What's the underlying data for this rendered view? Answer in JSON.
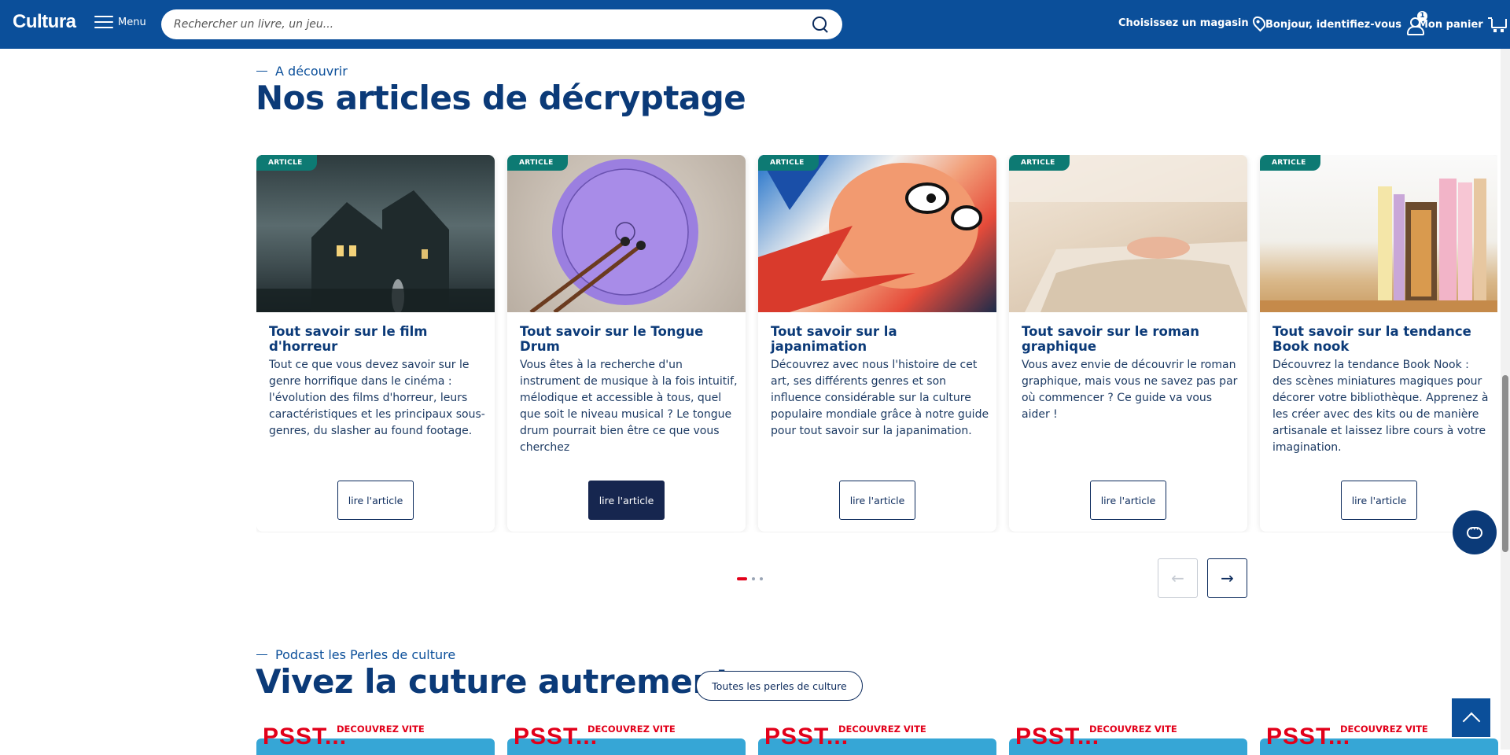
{
  "header": {
    "logo": "Cultura",
    "menu_label": "Menu",
    "search_placeholder": "Rechercher un livre, un jeu...",
    "store_label": "Choisissez un magasin",
    "account_label": "Bonjour, identifiez-vous",
    "account_badge": "1",
    "cart_label": "Mon panier",
    "brand_color": "#0b4f9a"
  },
  "decryptage": {
    "eyebrow": "A découvrir",
    "title": "Nos articles de décryptage",
    "cards": [
      {
        "tag": "ARTICLE",
        "image": "haunted-house-image",
        "title": "Tout savoir sur le film d'horreur",
        "desc": "Tout ce que vous devez savoir sur le genre horrifique dans le cinéma : l'évolution des films d'horreur, leurs caractéristiques et les principaux sous-genres, du slasher au found footage.",
        "button": "lire l'article"
      },
      {
        "tag": "ARTICLE",
        "image": "tongue-drum-image",
        "title": "Tout savoir sur le Tongue Drum",
        "desc": "Vous êtes à la recherche d'un instrument de musique à la fois intuitif, mélodique et accessible à tous, quel que soit le niveau musical ? Le tongue drum pourrait bien être ce que vous cherchez",
        "button": "lire l'article"
      },
      {
        "tag": "ARTICLE",
        "image": "anime-character-image",
        "title": "Tout savoir sur la japanimation",
        "desc": "Découvrez avec nous l'histoire de cet art, ses différents genres et son influence considérable sur la culture populaire mondiale grâce à notre guide pour tout savoir sur la japanimation.",
        "button": "lire l'article"
      },
      {
        "tag": "ARTICLE",
        "image": "reading-child-image",
        "title": "Tout savoir sur le roman graphique",
        "desc": "Vous avez envie de découvrir le roman graphique, mais vous ne savez pas par où commencer ? Ce guide va vous aider !",
        "button": "lire l'article"
      },
      {
        "tag": "ARTICLE",
        "image": "book-nook-image",
        "title": "Tout savoir sur la tendance Book nook",
        "desc": "Découvrez la tendance Book Nook : des scènes miniatures magiques pour décorer votre bibliothèque. Apprenez à les créer avec des kits ou de manière artisanale et laissez libre cours à votre imagination.",
        "button": "lire l'article"
      }
    ],
    "pager": {
      "pages": 3,
      "current": 1,
      "prev": "←",
      "next": "→"
    }
  },
  "podcast": {
    "eyebrow": "Podcast les Perles de culture",
    "title": "Vivez la cuture autrement",
    "all_button": "Toutes les perles de culture",
    "teaser": "PSST...",
    "teaser_sub": "DECOUVREZ VITE"
  }
}
